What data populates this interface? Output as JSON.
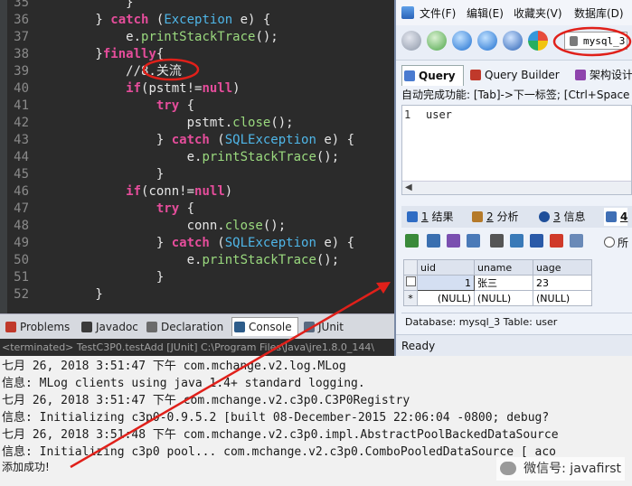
{
  "editor": {
    "lines": [
      {
        "num": "35",
        "tokens": [
          {
            "t": "            }",
            "c": "pu"
          }
        ]
      },
      {
        "num": "36",
        "tokens": [
          {
            "t": "        } ",
            "c": "pu"
          },
          {
            "t": "catch",
            "c": "kw"
          },
          {
            "t": " (",
            "c": "pu"
          },
          {
            "t": "Exception",
            "c": "ty"
          },
          {
            "t": " e) {",
            "c": "pu"
          }
        ]
      },
      {
        "num": "37",
        "tokens": [
          {
            "t": "            e.",
            "c": "pu"
          },
          {
            "t": "printStackTrace",
            "c": "mt"
          },
          {
            "t": "();",
            "c": "pu"
          }
        ]
      },
      {
        "num": "38",
        "tokens": [
          {
            "t": "        }",
            "c": "pu"
          },
          {
            "t": "finally",
            "c": "kw"
          },
          {
            "t": "{",
            "c": "pu"
          }
        ]
      },
      {
        "num": "39",
        "tokens": [
          {
            "t": "            //8.关流",
            "c": "cm"
          }
        ]
      },
      {
        "num": "40",
        "tokens": [
          {
            "t": "            ",
            "c": "pu"
          },
          {
            "t": "if",
            "c": "kw"
          },
          {
            "t": "(pstmt!=",
            "c": "pu"
          },
          {
            "t": "null",
            "c": "kw"
          },
          {
            "t": ")",
            "c": "pu"
          }
        ]
      },
      {
        "num": "41",
        "tokens": [
          {
            "t": "                ",
            "c": "pu"
          },
          {
            "t": "try",
            "c": "kw"
          },
          {
            "t": " {",
            "c": "pu"
          }
        ]
      },
      {
        "num": "42",
        "tokens": [
          {
            "t": "                    pstmt.",
            "c": "pu"
          },
          {
            "t": "close",
            "c": "mt"
          },
          {
            "t": "();",
            "c": "pu"
          }
        ]
      },
      {
        "num": "43",
        "tokens": [
          {
            "t": "                } ",
            "c": "pu"
          },
          {
            "t": "catch",
            "c": "kw"
          },
          {
            "t": " (",
            "c": "pu"
          },
          {
            "t": "SQLException",
            "c": "ty"
          },
          {
            "t": " e) {",
            "c": "pu"
          }
        ]
      },
      {
        "num": "44",
        "tokens": [
          {
            "t": "                    e.",
            "c": "pu"
          },
          {
            "t": "printStackTrace",
            "c": "mt"
          },
          {
            "t": "();",
            "c": "pu"
          }
        ]
      },
      {
        "num": "45",
        "tokens": [
          {
            "t": "                }",
            "c": "pu"
          }
        ]
      },
      {
        "num": "46",
        "tokens": [
          {
            "t": "            ",
            "c": "pu"
          },
          {
            "t": "if",
            "c": "kw"
          },
          {
            "t": "(conn!=",
            "c": "pu"
          },
          {
            "t": "null",
            "c": "kw"
          },
          {
            "t": ")",
            "c": "pu"
          }
        ]
      },
      {
        "num": "47",
        "tokens": [
          {
            "t": "                ",
            "c": "pu"
          },
          {
            "t": "try",
            "c": "kw"
          },
          {
            "t": " {",
            "c": "pu"
          }
        ]
      },
      {
        "num": "48",
        "tokens": [
          {
            "t": "                    conn.",
            "c": "pu"
          },
          {
            "t": "close",
            "c": "mt"
          },
          {
            "t": "();",
            "c": "pu"
          }
        ]
      },
      {
        "num": "49",
        "tokens": [
          {
            "t": "                } ",
            "c": "pu"
          },
          {
            "t": "catch",
            "c": "kw"
          },
          {
            "t": " (",
            "c": "pu"
          },
          {
            "t": "SQLException",
            "c": "ty"
          },
          {
            "t": " e) {",
            "c": "pu"
          }
        ]
      },
      {
        "num": "50",
        "tokens": [
          {
            "t": "                    e.",
            "c": "pu"
          },
          {
            "t": "printStackTrace",
            "c": "mt"
          },
          {
            "t": "();",
            "c": "pu"
          }
        ]
      },
      {
        "num": "51",
        "tokens": [
          {
            "t": "                }",
            "c": "pu"
          }
        ]
      },
      {
        "num": "52",
        "tokens": [
          {
            "t": "        }",
            "c": "pu"
          }
        ]
      }
    ]
  },
  "views": {
    "tabs": [
      {
        "label": "Problems",
        "icon": "problems-icon",
        "color": "#c0392b"
      },
      {
        "label": "Javadoc",
        "icon": "javadoc-icon",
        "color": "#3a3a3a"
      },
      {
        "label": "Declaration",
        "icon": "declaration-icon",
        "color": "#6b6b6b"
      },
      {
        "label": "Console",
        "icon": "console-icon",
        "color": "#2d5c8a"
      },
      {
        "label": "JUnit",
        "icon": "junit-icon",
        "color": "#5a6a80"
      }
    ],
    "status_line": "<terminated> TestC3P0.testAdd [JUnit] C:\\Program Files\\Java\\jre1.8.0_144\\"
  },
  "console": {
    "lines": [
      "七月 26, 2018 3:51:47 下午 com.mchange.v2.log.MLog",
      "信息: MLog clients using java 1.4+ standard logging.",
      "七月 26, 2018 3:51:47 下午 com.mchange.v2.c3p0.C3P0Registry",
      "信息: Initializing c3p0-0.9.5.2 [built 08-December-2015 22:06:04 -0800; debug?",
      "七月 26, 2018 3:51:48 下午 com.mchange.v2.c3p0.impl.AbstractPoolBackedDataSource",
      "信息: Initializing c3p0 pool... com.mchange.v2.c3p0.ComboPooledDataSource [ aco"
    ],
    "success": "添加成功!",
    "watermark": "微信号: javafirst"
  },
  "sqlyog": {
    "menu": [
      "文件(F)",
      "编辑(E)",
      "收藏夹(V)",
      "数据库(D)"
    ],
    "database": "mysql_3",
    "query_tabs": [
      {
        "label": "Query",
        "icon": "query-icon"
      },
      {
        "label": "Query Builder",
        "icon": "query-builder-icon"
      },
      {
        "label": "架构设计",
        "icon": "schema-designer-icon"
      }
    ],
    "autocomplete": "自动完成功能: [Tab]->下一标签; [Ctrl+Space",
    "editor": {
      "line_number": "1",
      "text": "user"
    },
    "result_tabs": [
      {
        "num": "1",
        "label": "结果",
        "icon": "result-icon"
      },
      {
        "num": "2",
        "label": "分析",
        "icon": "profile-icon"
      },
      {
        "num": "3",
        "label": "信息",
        "icon": "info-icon"
      },
      {
        "num": "4",
        "label": "",
        "icon": "table-data-icon"
      }
    ],
    "all_radio": "所",
    "grid": {
      "columns": [
        "uid",
        "uname",
        "uage"
      ],
      "rows": [
        [
          "1",
          "张三",
          "23"
        ],
        [
          "(NULL)",
          "(NULL)",
          "(NULL)"
        ]
      ],
      "new_row_marker": "*"
    },
    "db_info": "Database: mysql_3  Table: user",
    "status": "Ready"
  },
  "colors": {
    "editor_bg": "#2b2b2b",
    "keyword": "#e54d9b",
    "type": "#4fb6e8",
    "method": "#9ad97e",
    "annotation_red": "#e0201a"
  }
}
